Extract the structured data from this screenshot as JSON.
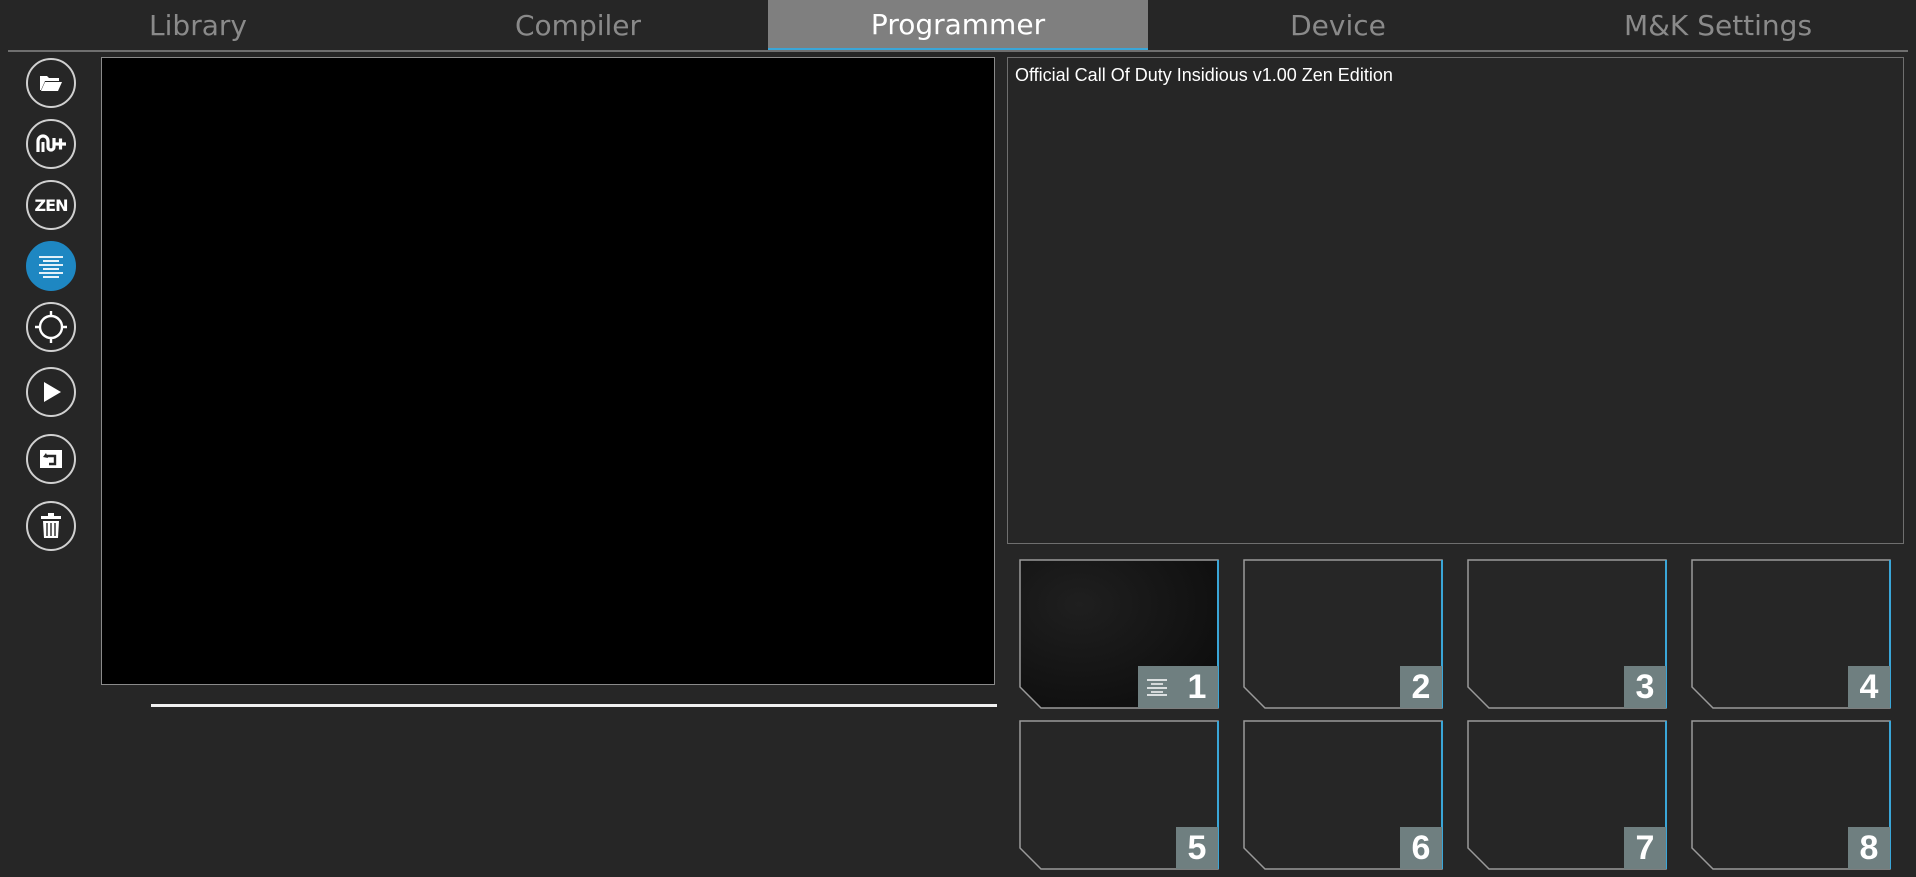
{
  "tabs": [
    {
      "label": "Library",
      "active": false
    },
    {
      "label": "Compiler",
      "active": false
    },
    {
      "label": "Programmer",
      "active": true
    },
    {
      "label": "Device",
      "active": false
    },
    {
      "label": "M&K Settings",
      "active": false
    }
  ],
  "toolbar": {
    "buttons": [
      {
        "name": "open-folder-button",
        "icon": "folder-open-icon"
      },
      {
        "name": "add-script-button",
        "icon": "gamepack-plus-icon"
      },
      {
        "name": "zen-button",
        "icon": "zen-icon",
        "text": "ZEN"
      },
      {
        "name": "list-view-button",
        "icon": "align-center-lines-icon",
        "active": true
      },
      {
        "name": "sync-button",
        "icon": "crosshair-sync-icon"
      },
      {
        "name": "run-button",
        "icon": "play-icon"
      },
      {
        "name": "restore-button",
        "icon": "window-restore-icon"
      },
      {
        "name": "delete-button",
        "icon": "trash-icon"
      }
    ]
  },
  "progress": {
    "fraction": 1.0
  },
  "info": {
    "text": "Official Call Of Duty Insidious v1.00 Zen Edition"
  },
  "slots": [
    {
      "number": "1",
      "loaded": true,
      "indicator_icon": "align-center-lines-icon"
    },
    {
      "number": "2",
      "loaded": false
    },
    {
      "number": "3",
      "loaded": false
    },
    {
      "number": "4",
      "loaded": false
    },
    {
      "number": "5",
      "loaded": false
    },
    {
      "number": "6",
      "loaded": false
    },
    {
      "number": "7",
      "loaded": false
    },
    {
      "number": "8",
      "loaded": false
    }
  ],
  "colors": {
    "background": "#262626",
    "accent": "#1e87c2",
    "slot_border_accent": "#3aa6d8",
    "slot_badge": "#6f7f80",
    "active_tab": "#7f7f7f"
  }
}
